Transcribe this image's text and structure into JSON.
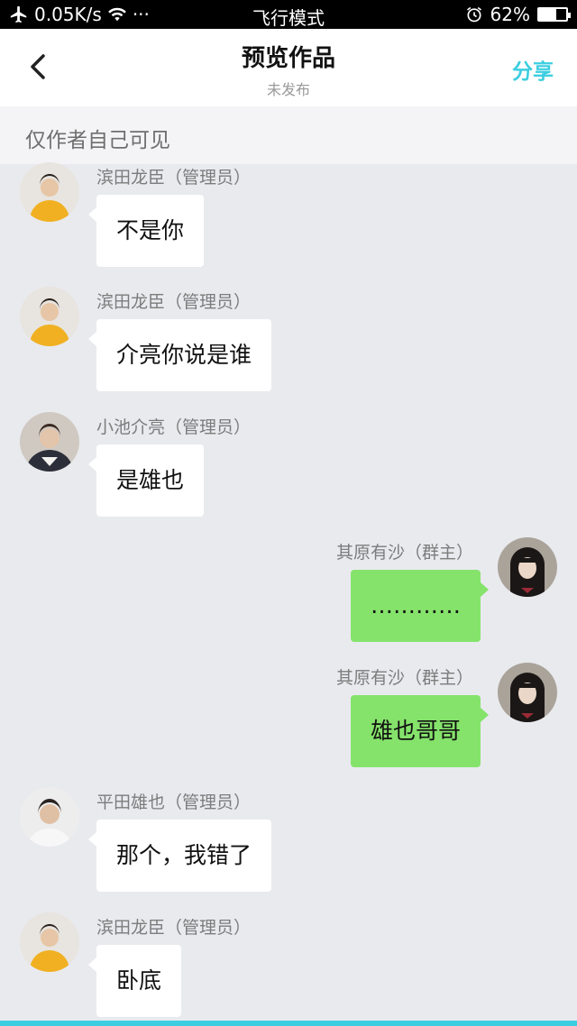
{
  "status_bar": {
    "speed": "0.05K/s",
    "dots": "···",
    "mode": "飞行模式",
    "battery": "62%",
    "battery_level": 0.62
  },
  "header": {
    "title": "预览作品",
    "subtitle": "未发布",
    "share_label": "分享"
  },
  "notice": "仅作者自己可见",
  "messages": [
    {
      "side": "left",
      "name": "滨田龙臣（管理员）",
      "text": "不是你"
    },
    {
      "side": "left",
      "name": "滨田龙臣（管理员）",
      "text": "介亮你说是谁"
    },
    {
      "side": "left",
      "name": "小池介亮（管理员）",
      "text": "是雄也"
    },
    {
      "side": "right",
      "name": "其原有沙（群主）",
      "text": "…………"
    },
    {
      "side": "right",
      "name": "其原有沙（群主）",
      "text": "雄也哥哥"
    },
    {
      "side": "left",
      "name": "平田雄也（管理员）",
      "text": "那个，我错了"
    },
    {
      "side": "left",
      "name": "滨田龙臣（管理员）",
      "text": "卧底"
    }
  ],
  "colors": {
    "accent": "#3ccee0",
    "self_bubble": "#85e36b",
    "other_bubble": "#ffffff",
    "background": "#e9eaee"
  }
}
